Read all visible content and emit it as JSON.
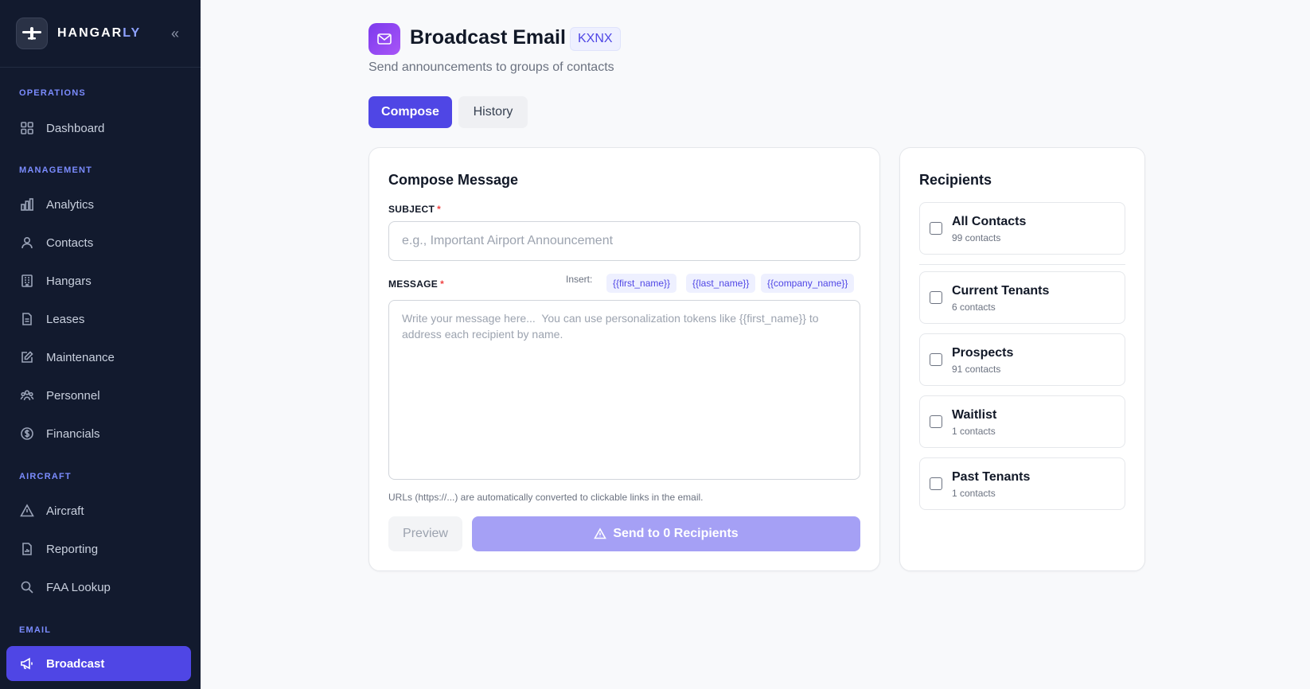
{
  "sidebar": {
    "brand_prefix": "HANGAR",
    "brand_suffix": "LY",
    "collapse_glyph": "«",
    "sections": {
      "operations": "OPERATIONS",
      "management": "MANAGEMENT",
      "aircraft": "AIRCRAFT",
      "email": "EMAIL"
    },
    "items": {
      "dashboard": "Dashboard",
      "analytics": "Analytics",
      "contacts": "Contacts",
      "hangars": "Hangars",
      "leases": "Leases",
      "maintenance": "Maintenance",
      "personnel": "Personnel",
      "financials": "Financials",
      "aircraft": "Aircraft",
      "reporting": "Reporting",
      "faa_lookup": "FAA Lookup",
      "broadcast": "Broadcast"
    },
    "active_item": "broadcast"
  },
  "header": {
    "title": "Broadcast Email",
    "badge": "KXNX",
    "subtitle": "Send announcements to groups of contacts"
  },
  "tabs": {
    "compose": "Compose",
    "history": "History",
    "active": "compose"
  },
  "compose": {
    "title": "Compose Message",
    "subject_label": "SUBJECT",
    "subject_value": "",
    "subject_placeholder": "e.g., Important Airport Announcement",
    "message_label": "MESSAGE",
    "required_mark": "*",
    "insert_label": "Insert:",
    "tokens": {
      "first_name": "{{first_name}}",
      "last_name": "{{last_name}}",
      "company_name": "{{company_name}}"
    },
    "message_value": "",
    "message_placeholder": "Write your message here...  You can use personalization tokens like {{first_name}} to address each recipient by name.",
    "hint": "URLs (https://...) are automatically converted to clickable links in the email.",
    "preview_label": "Preview",
    "send_label": "Send to 0 Recipients"
  },
  "recipients": {
    "title": "Recipients",
    "groups": [
      {
        "name": "All Contacts",
        "count": "99 contacts",
        "checked": false
      },
      {
        "name": "Current Tenants",
        "count": "6 contacts",
        "checked": false
      },
      {
        "name": "Prospects",
        "count": "91 contacts",
        "checked": false
      },
      {
        "name": "Waitlist",
        "count": "1 contacts",
        "checked": false
      },
      {
        "name": "Past Tenants",
        "count": "1 contacts",
        "checked": false
      }
    ]
  },
  "colors": {
    "sidebar_bg": "#121a2e",
    "accent": "#4f46e5",
    "section_label": "#7b8cff",
    "send_disabled": "#a5a0f5",
    "required": "#ef4444"
  },
  "icons": {
    "logo": "airplane-icon",
    "header": "mail-icon",
    "send": "warning-icon"
  }
}
